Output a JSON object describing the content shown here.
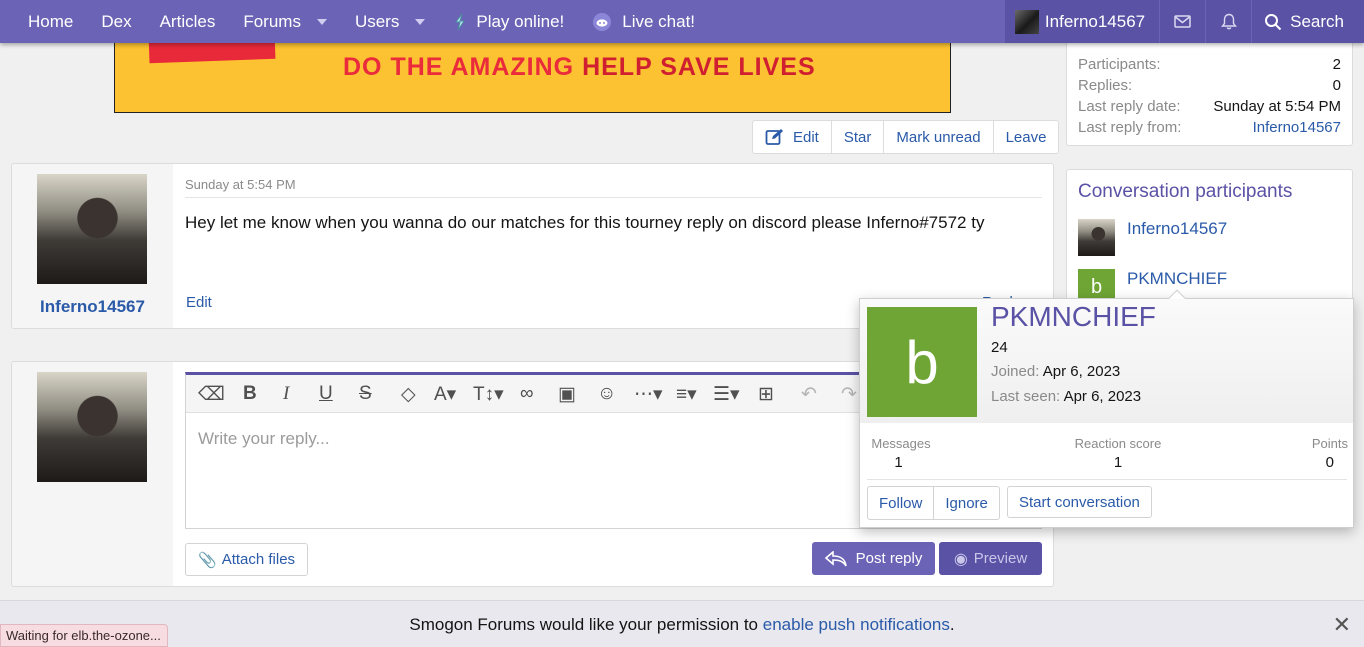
{
  "nav": {
    "home": "Home",
    "dex": "Dex",
    "articles": "Articles",
    "forums": "Forums",
    "users": "Users",
    "play_online": "Play online!",
    "live_chat": "Live chat!",
    "username": "Inferno14567",
    "search": "Search"
  },
  "banner": {
    "text_normal": "DO THE AMAZING ",
    "text_bold": "HELP SAVE LIVES"
  },
  "conversation_info": {
    "participants_label": "Participants:",
    "participants_value": "2",
    "replies_label": "Replies:",
    "replies_value": "0",
    "last_reply_date_label": "Last reply date:",
    "last_reply_date_value": "Sunday at 5:54 PM",
    "last_reply_from_label": "Last reply from:",
    "last_reply_from_value": "Inferno14567"
  },
  "thread_actions": {
    "edit": "Edit",
    "star": "Star",
    "mark_unread": "Mark unread",
    "leave": "Leave"
  },
  "message": {
    "author": "Inferno14567",
    "timestamp": "Sunday at 5:54 PM",
    "body": "Hey let me know when you wanna do our matches for this tourney reply on discord please Inferno#7572 ty",
    "edit": "Edit",
    "reply": "Reply"
  },
  "participants": {
    "title": "Conversation participants",
    "list": [
      {
        "name": "Inferno14567"
      },
      {
        "name": "PKMNCHIEF",
        "initial": "b"
      }
    ]
  },
  "editor": {
    "placeholder": "Write your reply...",
    "attach_files": "Attach files",
    "post_reply": "Post reply",
    "preview": "Preview"
  },
  "member_card": {
    "name": "PKMNCHIEF",
    "initial": "b",
    "avatar_color": "#6ea534",
    "subtitle": "24",
    "joined_label": "Joined:",
    "joined_value": "Apr 6, 2023",
    "last_seen_label": "Last seen:",
    "last_seen_value": "Apr 6, 2023",
    "stats": [
      {
        "label": "Messages",
        "value": "1"
      },
      {
        "label": "Reaction score",
        "value": "1"
      },
      {
        "label": "Points",
        "value": "0"
      }
    ],
    "follow": "Follow",
    "ignore": "Ignore",
    "start_conversation": "Start conversation"
  },
  "notice": {
    "text": "Smogon Forums would like your permission to ",
    "link": "enable push notifications",
    "end": "."
  },
  "status_bar": "Waiting for elb.the-ozone...",
  "colors": {
    "nav": "#6b63b5",
    "link": "#2a5aa8",
    "accent": "#5a52a5",
    "banner": "#fcc231"
  }
}
